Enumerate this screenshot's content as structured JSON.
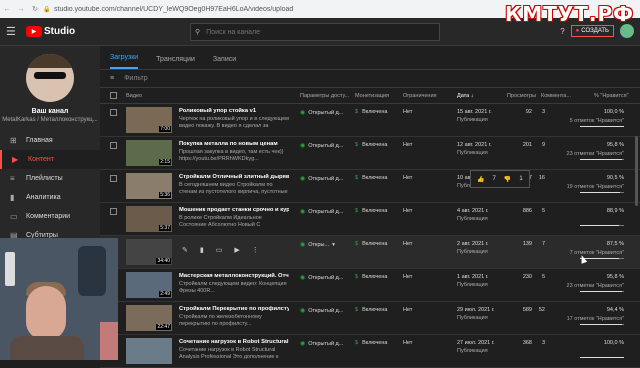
{
  "browser": {
    "url": "studio.youtube.com/channel/UCDY_leWQ9Oeg0H97EaH6LoA/videos/upload"
  },
  "watermark": "КМТУТ.РФ",
  "header": {
    "logo_text": "Studio",
    "search_placeholder": "Поиск на канале",
    "create_label": "СОЗДАТЬ"
  },
  "channel": {
    "name": "Ваш канал",
    "subtitle": "MetalKarkas / Металлоконструкц..."
  },
  "sidebar": {
    "items": [
      {
        "icon": "⊞",
        "label": "Главная"
      },
      {
        "icon": "▶",
        "label": "Контент"
      },
      {
        "icon": "≡",
        "label": "Плейлисты"
      },
      {
        "icon": "▮",
        "label": "Аналитика"
      },
      {
        "icon": "▭",
        "label": "Комментарии"
      },
      {
        "icon": "▤",
        "label": "Субтитры"
      }
    ]
  },
  "tabs": [
    "Загрузки",
    "Трансляции",
    "Записи"
  ],
  "filter_label": "Фильтр",
  "columns": {
    "video": "Видео",
    "access": "Параметры досту...",
    "monetization": "Монетизация",
    "restrictions": "Ограничения",
    "date": "Дата ↓",
    "views": "Просмотры",
    "comments": "Коммента...",
    "likes": "% \"Нравится\""
  },
  "rows": [
    {
      "title": "Роликовый упор стойка v1",
      "desc": "Чертеж на роликовый упор и в следующем видео покажу. В видео я сделал за вечер...",
      "duration": "7:00",
      "access": "Открытый д...",
      "mon": "Включена",
      "res": "Нет",
      "date": "15 авг. 2021 г.",
      "date_sub": "Публикация",
      "views": "92",
      "comments": "3",
      "likes": "100,0 %",
      "likes_sub": "5 отметок \"Нравится\"",
      "ratio": 1.0
    },
    {
      "title": "Покупка металла по новым ценам",
      "desc": "Прошлая закупка в видео, там есть чек)) https://youtu.be/PRRhWKDkyg...",
      "duration": "2:15",
      "access": "Открытый д...",
      "mon": "Включена",
      "res": "Нет",
      "date": "12 авг. 2021 г.",
      "date_sub": "Публикация",
      "views": "201",
      "comments": "9",
      "likes": "95,8 %",
      "likes_sub": "23 отметки \"Нравится\"",
      "ratio": 0.958
    },
    {
      "title": "Стройкалм Отличный злитный дырявый д...",
      "desc": "В сегодняшнем видео Стройкалм по стенам из пустотелого кирпича, пустотные в кирпиче...",
      "duration": "5:36",
      "access": "Открытый д...",
      "mon": "Включена",
      "res": "Нет",
      "date": "10 авг. 2021 г.",
      "date_sub": "Публикация",
      "views": "357",
      "comments": "16",
      "likes": "90,5 %",
      "likes_sub": "19 отметок \"Нравится\"",
      "ratio": 0.905
    },
    {
      "title": "Мошеник продает станки срочно и курга",
      "desc": "В ролике Стройкалм Идеальное Состояние Абсолютно Новый С консервации Не Разу Не...",
      "duration": "5:37",
      "access": "Открытый д...",
      "mon": "Включена",
      "res": "Нет",
      "date": "4 авг. 2021 г.",
      "date_sub": "Публикация",
      "views": "886",
      "comments": "5",
      "likes": "88,9 %",
      "likes_sub": "",
      "ratio": 0.889
    },
    {
      "title": "",
      "desc": "",
      "duration": "34:40",
      "access": "Откры...",
      "mon": "Включена",
      "res": "Нет",
      "date": "2 авг. 2021 г.",
      "date_sub": "Публикация",
      "views": "139",
      "comments": "7",
      "likes": "87,5 %",
      "likes_sub": "7 отметок \"Нравится\"",
      "ratio": 0.875
    },
    {
      "title": "Мастерская металлоконструкций. Отчет з...",
      "desc": "Стройкалм следующем видео: Концепция Фрезы 400R...",
      "duration": "2:49",
      "access": "Открытый д...",
      "mon": "Включена",
      "res": "Нет",
      "date": "1 авг. 2021 г.",
      "date_sub": "Публикация",
      "views": "230",
      "comments": "5",
      "likes": "95,8 %",
      "likes_sub": "23 отметки \"Нравится\"",
      "ratio": 0.958
    },
    {
      "title": "Стройкалм Перекрытие по профилсту",
      "desc": "Стройкалм по железобетонному перекрытию по профилсту...",
      "duration": "22:47",
      "access": "Открытый д...",
      "mon": "Включена",
      "res": "Нет",
      "date": "29 июл. 2021 г.",
      "date_sub": "Публикация",
      "views": "589",
      "comments": "52",
      "likes": "94,4 %",
      "likes_sub": "17 отметок \"Нравится\"",
      "ratio": 0.944
    },
    {
      "title": "Сочетание нагрузок в Robot Structural Anal...",
      "desc": "Сочетание нагрузок в Robot Structural Analysis Professional Это дополнение к видео...",
      "duration": "",
      "access": "Открытый д...",
      "mon": "Включена",
      "res": "Нет",
      "date": "27 июл. 2021 г.",
      "date_sub": "Публикация",
      "views": "368",
      "comments": "3",
      "likes": "100,0 %",
      "likes_sub": "",
      "ratio": 1.0
    }
  ],
  "tooltip": {
    "likes": "7",
    "dislikes": "1"
  }
}
